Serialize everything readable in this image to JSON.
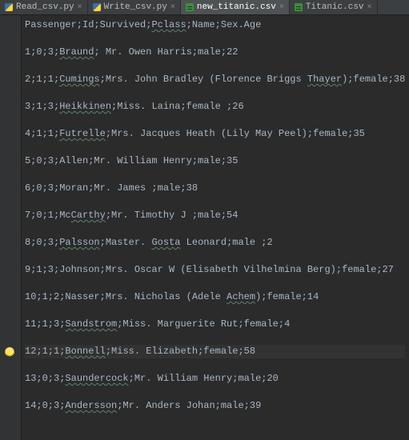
{
  "tabs": [
    {
      "icon": "py",
      "label": "Read_csv.py",
      "active": false
    },
    {
      "icon": "py",
      "label": "Write_csv.py",
      "active": false
    },
    {
      "icon": "csv",
      "label": "new_titanic.csv",
      "active": true
    },
    {
      "icon": "csv",
      "label": "Titanic.csv",
      "active": false
    }
  ],
  "lines": [
    {
      "pre": "Passenger;Id;Survived;",
      "u": "Pclass",
      "post": ";Name;Sex.Age"
    },
    {
      "blank": true
    },
    {
      "pre": "1;0;3;",
      "u": "Braund",
      "post": "; Mr. Owen Harris;male;22"
    },
    {
      "blank": true
    },
    {
      "pre": "2;1;1;",
      "u": "Cumings",
      "mid": ";Mrs. John Bradley (Florence Briggs ",
      "u2": "Thayer",
      "post": ");female;38"
    },
    {
      "blank": true
    },
    {
      "pre": "3;1;3;",
      "u": "Heikkinen",
      "post": ";Miss. Laina;female ;26"
    },
    {
      "blank": true
    },
    {
      "pre": "4;1;1;",
      "u": "Futrelle",
      "post": ";Mrs. Jacques Heath (Lily May Peel);female;35"
    },
    {
      "blank": true
    },
    {
      "pre": "5;0;3;Allen;Mr. William Henry;male;35"
    },
    {
      "blank": true
    },
    {
      "pre": "6;0;3;Moran;Mr. James ;male;38"
    },
    {
      "blank": true
    },
    {
      "pre": "7;0;1;Mc",
      "u": "Carthy",
      "post": ";Mr. Timothy J ;male;54"
    },
    {
      "blank": true
    },
    {
      "pre": "8;0;3;",
      "u": "Palsson",
      "mid": ";Master. ",
      "u2": "Gosta",
      "post": " Leonard;male ;2"
    },
    {
      "blank": true
    },
    {
      "pre": "9;1;3;Johnson;Mrs. Oscar W (Elisabeth Vilhelmina Berg);female;27"
    },
    {
      "blank": true
    },
    {
      "pre": "10;1;2;Nasser;Mrs. Nicholas (Adele ",
      "u": "Achem",
      "post": ");female;14"
    },
    {
      "blank": true
    },
    {
      "pre": "11;1;3;",
      "u": "Sandstrom",
      "post": ";Miss. Marguerite Rut;female;4"
    },
    {
      "blank": true
    },
    {
      "pre": "12;1;1;",
      "u": "Bonnell",
      "post": ";Miss. Elizabeth;female;58",
      "hl": true
    },
    {
      "blank": true
    },
    {
      "pre": "13;0;3;",
      "u": "Saundercock",
      "post": ";Mr. William Henry;male;20"
    },
    {
      "blank": true
    },
    {
      "pre": "14;0;3;",
      "u": "Andersson",
      "post": ";Mr. Anders Johan;male;39"
    }
  ],
  "close_glyph": "×"
}
